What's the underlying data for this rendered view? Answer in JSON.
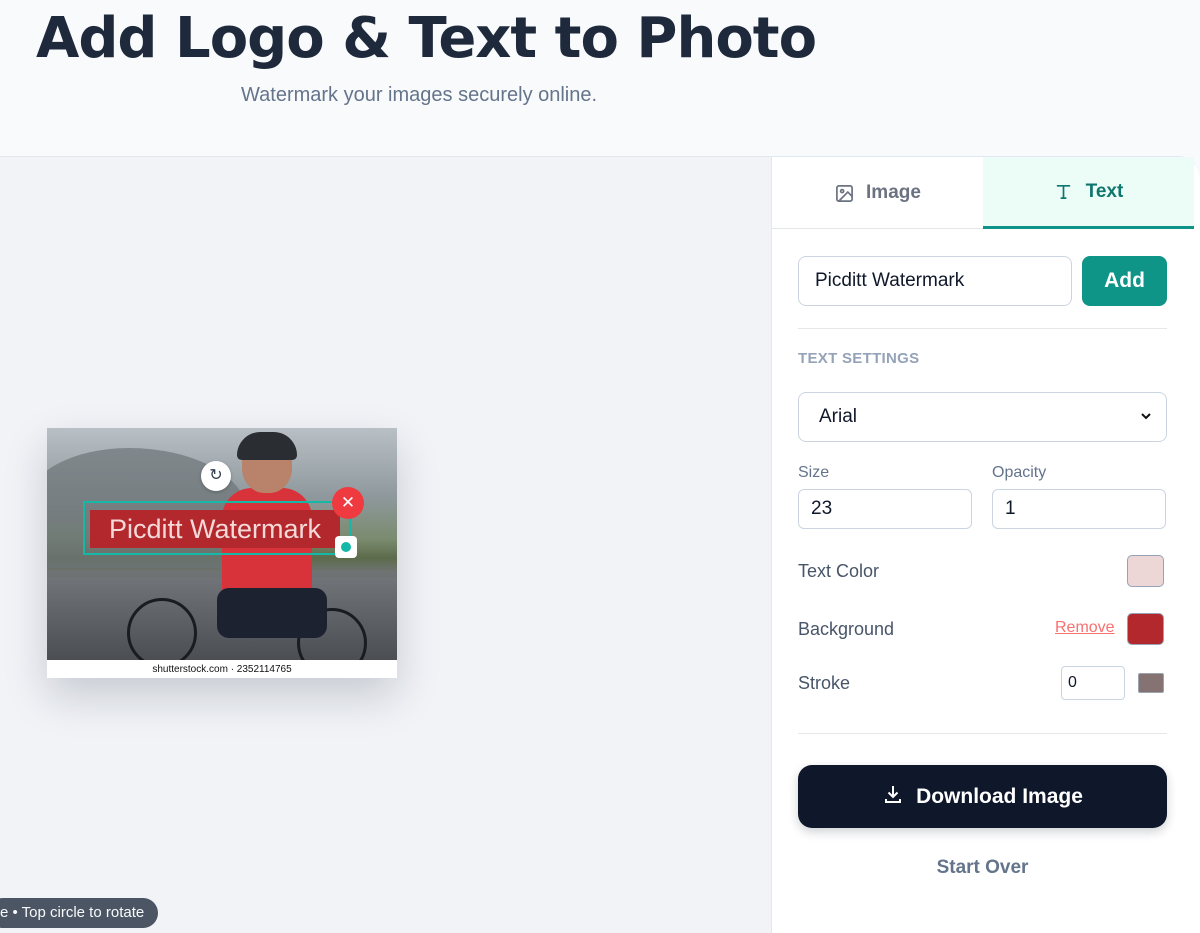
{
  "header": {
    "title": "Add Logo & Text to Photo",
    "subtitle": "Watermark your images securely online."
  },
  "canvas": {
    "watermark_text": "Picditt Watermark",
    "photo_caption": "shutterstock.com · 2352114765",
    "hint": "e • Top circle to rotate"
  },
  "panel": {
    "tabs": [
      {
        "label": "Image",
        "icon": "image-icon",
        "active": false
      },
      {
        "label": "Text",
        "icon": "text-type-icon",
        "active": true
      }
    ],
    "text_input_value": "Picditt Watermark",
    "add_label": "Add",
    "section_label": "TEXT SETTINGS",
    "font": "Arial",
    "size_label": "Size",
    "size_value": "23",
    "opacity_label": "Opacity",
    "opacity_value": "1",
    "text_color_label": "Text Color",
    "text_color": "#ecd6d6",
    "background_label": "Background",
    "remove_label": "Remove",
    "background_color": "#b3282d",
    "stroke_label": "Stroke",
    "stroke_value": "0",
    "stroke_color": "#857373",
    "download_label": "Download Image",
    "start_over_label": "Start Over"
  },
  "colors": {
    "accent": "#0d9488",
    "dark": "#0f172a",
    "danger": "#ef3a3f"
  }
}
